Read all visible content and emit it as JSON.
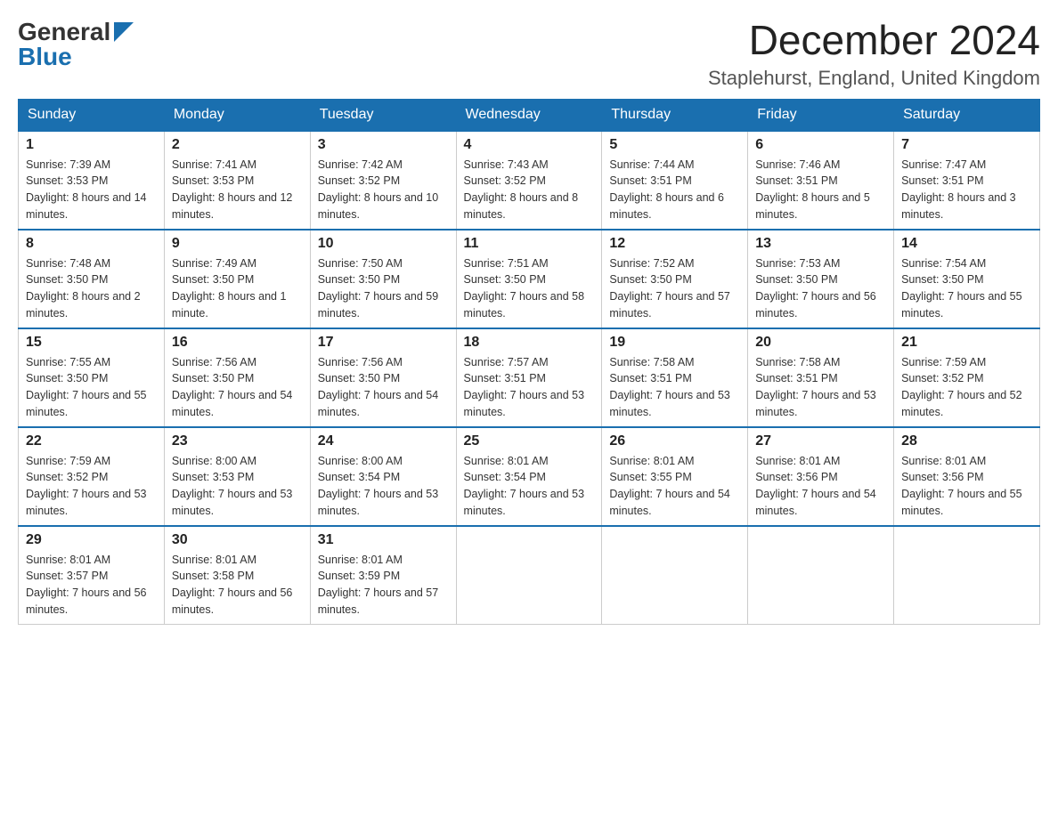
{
  "header": {
    "logo_general": "General",
    "logo_blue": "Blue",
    "month_year": "December 2024",
    "location": "Staplehurst, England, United Kingdom"
  },
  "weekdays": [
    "Sunday",
    "Monday",
    "Tuesday",
    "Wednesday",
    "Thursday",
    "Friday",
    "Saturday"
  ],
  "weeks": [
    [
      {
        "day": "1",
        "sunrise": "7:39 AM",
        "sunset": "3:53 PM",
        "daylight": "8 hours and 14 minutes."
      },
      {
        "day": "2",
        "sunrise": "7:41 AM",
        "sunset": "3:53 PM",
        "daylight": "8 hours and 12 minutes."
      },
      {
        "day": "3",
        "sunrise": "7:42 AM",
        "sunset": "3:52 PM",
        "daylight": "8 hours and 10 minutes."
      },
      {
        "day": "4",
        "sunrise": "7:43 AM",
        "sunset": "3:52 PM",
        "daylight": "8 hours and 8 minutes."
      },
      {
        "day": "5",
        "sunrise": "7:44 AM",
        "sunset": "3:51 PM",
        "daylight": "8 hours and 6 minutes."
      },
      {
        "day": "6",
        "sunrise": "7:46 AM",
        "sunset": "3:51 PM",
        "daylight": "8 hours and 5 minutes."
      },
      {
        "day": "7",
        "sunrise": "7:47 AM",
        "sunset": "3:51 PM",
        "daylight": "8 hours and 3 minutes."
      }
    ],
    [
      {
        "day": "8",
        "sunrise": "7:48 AM",
        "sunset": "3:50 PM",
        "daylight": "8 hours and 2 minutes."
      },
      {
        "day": "9",
        "sunrise": "7:49 AM",
        "sunset": "3:50 PM",
        "daylight": "8 hours and 1 minute."
      },
      {
        "day": "10",
        "sunrise": "7:50 AM",
        "sunset": "3:50 PM",
        "daylight": "7 hours and 59 minutes."
      },
      {
        "day": "11",
        "sunrise": "7:51 AM",
        "sunset": "3:50 PM",
        "daylight": "7 hours and 58 minutes."
      },
      {
        "day": "12",
        "sunrise": "7:52 AM",
        "sunset": "3:50 PM",
        "daylight": "7 hours and 57 minutes."
      },
      {
        "day": "13",
        "sunrise": "7:53 AM",
        "sunset": "3:50 PM",
        "daylight": "7 hours and 56 minutes."
      },
      {
        "day": "14",
        "sunrise": "7:54 AM",
        "sunset": "3:50 PM",
        "daylight": "7 hours and 55 minutes."
      }
    ],
    [
      {
        "day": "15",
        "sunrise": "7:55 AM",
        "sunset": "3:50 PM",
        "daylight": "7 hours and 55 minutes."
      },
      {
        "day": "16",
        "sunrise": "7:56 AM",
        "sunset": "3:50 PM",
        "daylight": "7 hours and 54 minutes."
      },
      {
        "day": "17",
        "sunrise": "7:56 AM",
        "sunset": "3:50 PM",
        "daylight": "7 hours and 54 minutes."
      },
      {
        "day": "18",
        "sunrise": "7:57 AM",
        "sunset": "3:51 PM",
        "daylight": "7 hours and 53 minutes."
      },
      {
        "day": "19",
        "sunrise": "7:58 AM",
        "sunset": "3:51 PM",
        "daylight": "7 hours and 53 minutes."
      },
      {
        "day": "20",
        "sunrise": "7:58 AM",
        "sunset": "3:51 PM",
        "daylight": "7 hours and 53 minutes."
      },
      {
        "day": "21",
        "sunrise": "7:59 AM",
        "sunset": "3:52 PM",
        "daylight": "7 hours and 52 minutes."
      }
    ],
    [
      {
        "day": "22",
        "sunrise": "7:59 AM",
        "sunset": "3:52 PM",
        "daylight": "7 hours and 53 minutes."
      },
      {
        "day": "23",
        "sunrise": "8:00 AM",
        "sunset": "3:53 PM",
        "daylight": "7 hours and 53 minutes."
      },
      {
        "day": "24",
        "sunrise": "8:00 AM",
        "sunset": "3:54 PM",
        "daylight": "7 hours and 53 minutes."
      },
      {
        "day": "25",
        "sunrise": "8:01 AM",
        "sunset": "3:54 PM",
        "daylight": "7 hours and 53 minutes."
      },
      {
        "day": "26",
        "sunrise": "8:01 AM",
        "sunset": "3:55 PM",
        "daylight": "7 hours and 54 minutes."
      },
      {
        "day": "27",
        "sunrise": "8:01 AM",
        "sunset": "3:56 PM",
        "daylight": "7 hours and 54 minutes."
      },
      {
        "day": "28",
        "sunrise": "8:01 AM",
        "sunset": "3:56 PM",
        "daylight": "7 hours and 55 minutes."
      }
    ],
    [
      {
        "day": "29",
        "sunrise": "8:01 AM",
        "sunset": "3:57 PM",
        "daylight": "7 hours and 56 minutes."
      },
      {
        "day": "30",
        "sunrise": "8:01 AM",
        "sunset": "3:58 PM",
        "daylight": "7 hours and 56 minutes."
      },
      {
        "day": "31",
        "sunrise": "8:01 AM",
        "sunset": "3:59 PM",
        "daylight": "7 hours and 57 minutes."
      },
      null,
      null,
      null,
      null
    ]
  ]
}
